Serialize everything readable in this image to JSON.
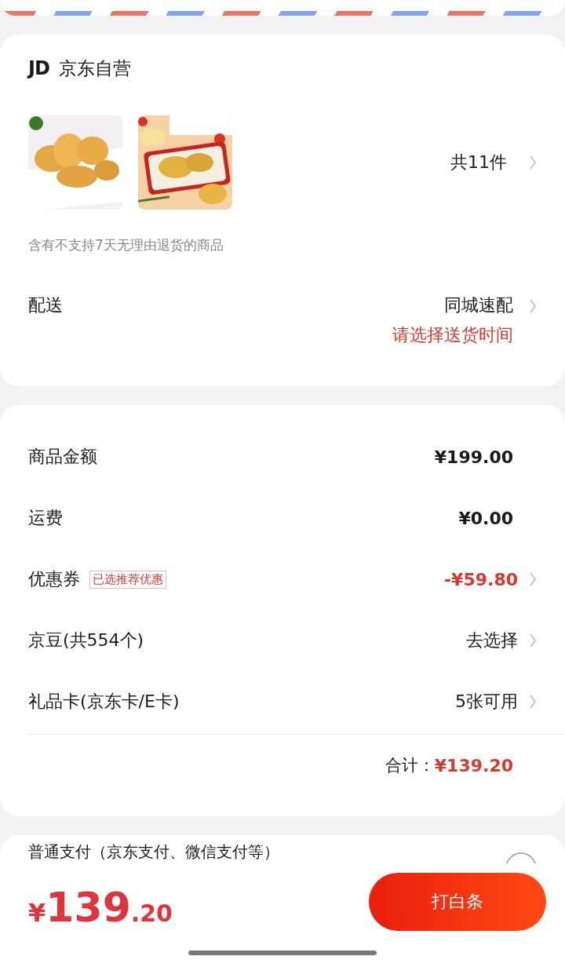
{
  "store": {
    "logo": "JD",
    "name": "京东自营"
  },
  "items": {
    "count": "共11件",
    "note": "含有不支持7天无理由退货的商品"
  },
  "delivery": {
    "label": "配送",
    "method": "同城速配",
    "prompt": "请选择送货时间"
  },
  "summary": {
    "rows": [
      {
        "label": "商品金额",
        "value": "¥199.00",
        "kind": "plain"
      },
      {
        "label": "运费",
        "value": "¥0.00",
        "kind": "plain"
      },
      {
        "label": "优惠券",
        "tag": "已选推荐优惠",
        "value": "-¥59.80",
        "kind": "discount"
      },
      {
        "label": "京豆(共554个)",
        "value": "去选择",
        "kind": "link"
      },
      {
        "label": "礼品卡(京东卡/E卡)",
        "value": "5张可用",
        "kind": "link"
      }
    ],
    "total_label": "合计：",
    "total": "¥139.20"
  },
  "payment": {
    "option": "普通支付（京东支付、微信支付等）",
    "selected": false
  },
  "footer": {
    "currency": "¥",
    "amount": "139",
    "decimals": ".20",
    "button": "打白条"
  }
}
